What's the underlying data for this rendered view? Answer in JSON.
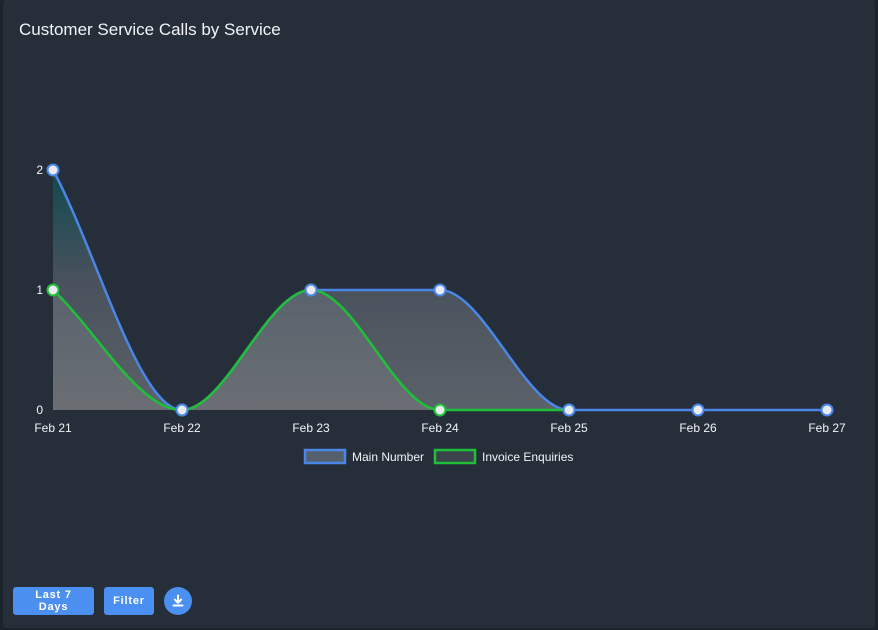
{
  "title": "Customer Service Calls by Service",
  "chart_data": {
    "type": "area",
    "categories": [
      "Feb 21",
      "Feb 22",
      "Feb 23",
      "Feb 24",
      "Feb 25",
      "Feb 26",
      "Feb 27"
    ],
    "series": [
      {
        "name": "Main Number",
        "values": [
          2,
          0,
          1,
          1,
          0,
          0,
          0
        ],
        "color": "#4a86e8"
      },
      {
        "name": "Invoice Enquiries",
        "values": [
          1,
          0,
          1,
          0,
          0,
          null,
          null
        ],
        "color": "#1fbf3a"
      }
    ],
    "yticks": [
      0,
      1,
      2
    ],
    "ylim": [
      0,
      2
    ],
    "grid": false,
    "legend": "bottom"
  },
  "controls": {
    "range_label": "Last 7 Days",
    "filter_label": "Filter",
    "download_icon": "download-icon"
  }
}
